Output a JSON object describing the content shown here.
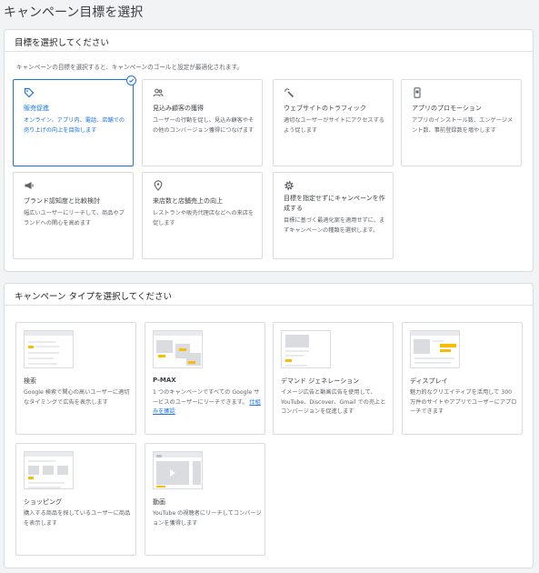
{
  "page": {
    "title": "キャンペーン目標を選択"
  },
  "goal_section": {
    "header": "目標を選択してください",
    "description": "キャンペーンの目標を選択すると、キャンペーンのゴールと設定が最適化されます。",
    "cards": [
      {
        "icon": "tag-icon",
        "title": "販売促進",
        "description": "オンライン、アプリ内、電話、店舗での売り上げの向上を目指します",
        "selected": true
      },
      {
        "icon": "people-icon",
        "title": "見込み顧客の獲得",
        "description": "ユーザーの行動を促し、見込み顧客やその他のコンバージョン獲得につなげます",
        "selected": false
      },
      {
        "icon": "magic-click-icon",
        "title": "ウェブサイトのトラフィック",
        "description": "適切なユーザーがサイトにアクセスするよう促します",
        "selected": false
      },
      {
        "icon": "mobile-phone-icon",
        "title": "アプリのプロモーション",
        "description": "アプリのインストール数、エンゲージメント数、事前登録数を増やします",
        "selected": false
      },
      {
        "icon": "megaphone-icon",
        "title": "ブランド認知度と比較検討",
        "description": "幅広いユーザーにリーチして、商品やブランドへの関心を高めます",
        "selected": false
      },
      {
        "icon": "location-pin-icon",
        "title": "来店数と店舗売上の向上",
        "description": "レストランや販売代理店などへの来店を促します",
        "selected": false
      },
      {
        "icon": "gear-icon",
        "title": "目標を指定せずにキャンペーンを作成する",
        "description": "目標に基づく最適化案を適用せずに、まずキャンペーンの種類を選択します。",
        "selected": false
      }
    ]
  },
  "type_section": {
    "header": "キャンペーン タイプを選択してください",
    "cards": [
      {
        "thumb": "search",
        "title": "検索",
        "description": "Google 検索で関心の高いユーザーに適切なタイミングで広告を表示します"
      },
      {
        "thumb": "pmax",
        "title": "P-MAX",
        "description": "1 つのキャンペーンですべての Google サービスのユーザーにリーチできます。",
        "link": "仕組みを確認"
      },
      {
        "thumb": "demand-gen",
        "title": "デマンド ジェネレーション",
        "description": "イメージ広告と動画広告を使用して、YouTube、Discover、Gmail での売上とコンバージョンを促進します"
      },
      {
        "thumb": "display",
        "title": "ディスプレイ",
        "description": "魅力的なクリエイティブを活用して 300 万件のサイトやアプリでユーザーにアプローチできます"
      },
      {
        "thumb": "shopping",
        "title": "ショッピング",
        "description": "購入する商品を探しているユーザーに商品を表示します"
      },
      {
        "thumb": "video",
        "title": "動画",
        "description": "YouTube の視聴者にリーチしてコンバージョンを獲得します"
      }
    ]
  },
  "colors": {
    "accent": "#1a73e8",
    "thumb_highlight": "#fbbc04",
    "border": "#dadce0"
  }
}
